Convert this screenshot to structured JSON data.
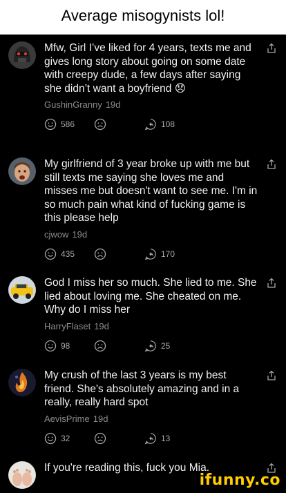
{
  "caption": "Average misogynists lol!",
  "colors": {
    "background": "#000000",
    "text": "#f2f2f2",
    "meta": "#8c8c8c",
    "watermark": "#ffcc00"
  },
  "comments": [
    {
      "text": "Mfw, Girl I’ve liked for 4 years, texts me and gives long story about going on some date with creepy dude, a few days after saying she didn’t want a boyfriend 😞",
      "username": "GushinGranny",
      "age": "19d",
      "likes": "586",
      "replies": "108",
      "avatar_icon": "helmet-avatar-icon"
    },
    {
      "text": "My girlfriend of 3 year broke up with me but still texts me saying she loves me and misses me but doesn't want to see me. I'm in so much pain what kind of fucking game is this please help",
      "username": "cjwow",
      "age": "19d",
      "likes": "435",
      "replies": "170",
      "avatar_icon": "face-avatar-icon"
    },
    {
      "text": "God I miss her so much. She lied to me. She lied about loving me. She cheated on me. Why do I miss her",
      "username": "HarryFlaset",
      "age": "19d",
      "likes": "98",
      "replies": "25",
      "avatar_icon": "yellow-car-avatar-icon"
    },
    {
      "text": "My crush of the last 3 years is my best friend. She's absolutely amazing and in a really, really hard spot",
      "username": "AevisPrime",
      "age": "19d",
      "likes": "32",
      "replies": "13",
      "avatar_icon": "fire-avatar-icon"
    },
    {
      "text": "If you're reading this, fuck you Mia.",
      "avatar_icon": "feet-avatar-icon"
    }
  ],
  "watermark": "ifunny.co"
}
